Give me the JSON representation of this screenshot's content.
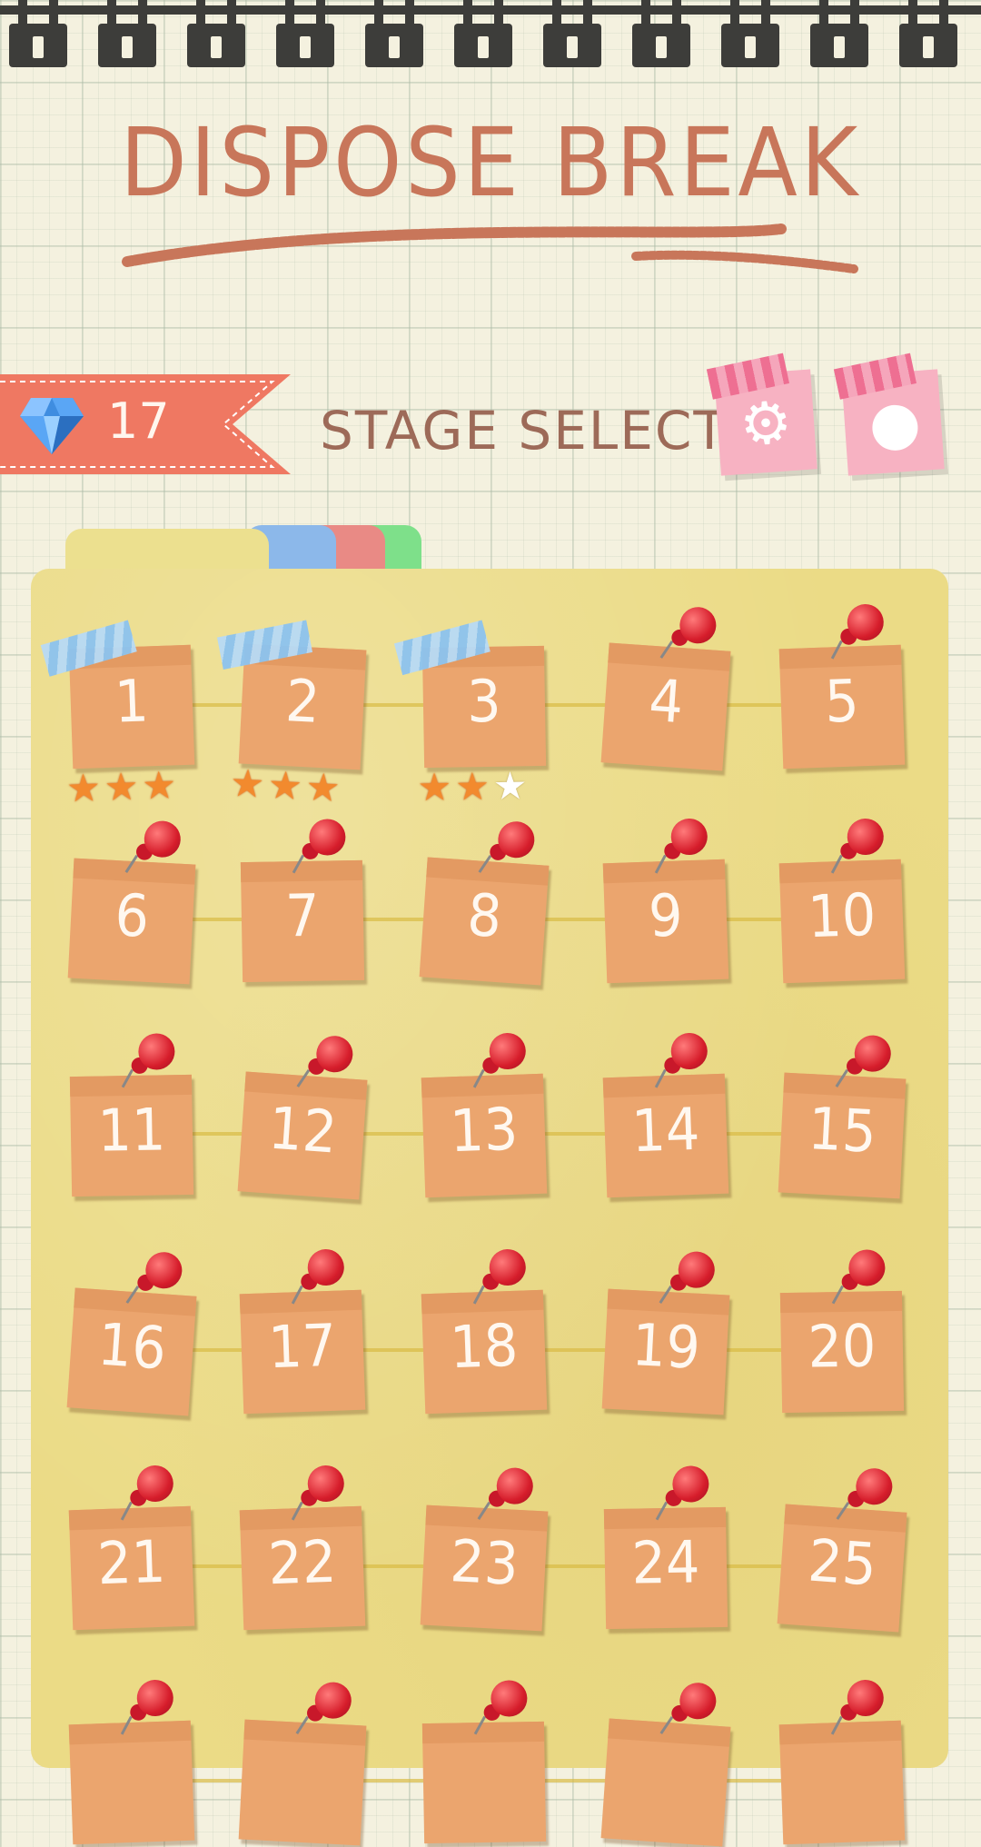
{
  "game_title": "DISPOSE BREAK",
  "header": {
    "gem_count": "17",
    "stage_select_label": "STAGE SELECT",
    "gem_icon": "diamond-icon",
    "settings_icon": "gear-icon",
    "record_icon": "record-icon"
  },
  "colors": {
    "accent": "#c8765a",
    "ribbon": "#ef7862",
    "folder": "#ebdb86",
    "card": "#eba56e",
    "pink_button": "#f7b2c2"
  },
  "tabs": [
    {
      "name": "yellow"
    },
    {
      "name": "blue"
    },
    {
      "name": "red"
    },
    {
      "name": "green"
    }
  ],
  "stages": [
    {
      "number": "1",
      "stars": 3,
      "unlocked": true
    },
    {
      "number": "2",
      "stars": 3,
      "unlocked": true
    },
    {
      "number": "3",
      "stars": 2,
      "unlocked": true
    },
    {
      "number": "4",
      "stars": 0,
      "unlocked": false
    },
    {
      "number": "5",
      "stars": 0,
      "unlocked": false
    },
    {
      "number": "6",
      "stars": 0,
      "unlocked": false
    },
    {
      "number": "7",
      "stars": 0,
      "unlocked": false
    },
    {
      "number": "8",
      "stars": 0,
      "unlocked": false
    },
    {
      "number": "9",
      "stars": 0,
      "unlocked": false
    },
    {
      "number": "10",
      "stars": 0,
      "unlocked": false
    },
    {
      "number": "11",
      "stars": 0,
      "unlocked": false
    },
    {
      "number": "12",
      "stars": 0,
      "unlocked": false
    },
    {
      "number": "13",
      "stars": 0,
      "unlocked": false
    },
    {
      "number": "14",
      "stars": 0,
      "unlocked": false
    },
    {
      "number": "15",
      "stars": 0,
      "unlocked": false
    },
    {
      "number": "16",
      "stars": 0,
      "unlocked": false
    },
    {
      "number": "17",
      "stars": 0,
      "unlocked": false
    },
    {
      "number": "18",
      "stars": 0,
      "unlocked": false
    },
    {
      "number": "19",
      "stars": 0,
      "unlocked": false
    },
    {
      "number": "20",
      "stars": 0,
      "unlocked": false
    },
    {
      "number": "21",
      "stars": 0,
      "unlocked": false
    },
    {
      "number": "22",
      "stars": 0,
      "unlocked": false
    },
    {
      "number": "23",
      "stars": 0,
      "unlocked": false
    },
    {
      "number": "24",
      "stars": 0,
      "unlocked": false
    },
    {
      "number": "25",
      "stars": 0,
      "unlocked": false
    },
    {
      "number": "",
      "stars": 0,
      "unlocked": false
    },
    {
      "number": "",
      "stars": 0,
      "unlocked": false
    },
    {
      "number": "",
      "stars": 0,
      "unlocked": false
    },
    {
      "number": "",
      "stars": 0,
      "unlocked": false
    },
    {
      "number": "",
      "stars": 0,
      "unlocked": false
    }
  ]
}
